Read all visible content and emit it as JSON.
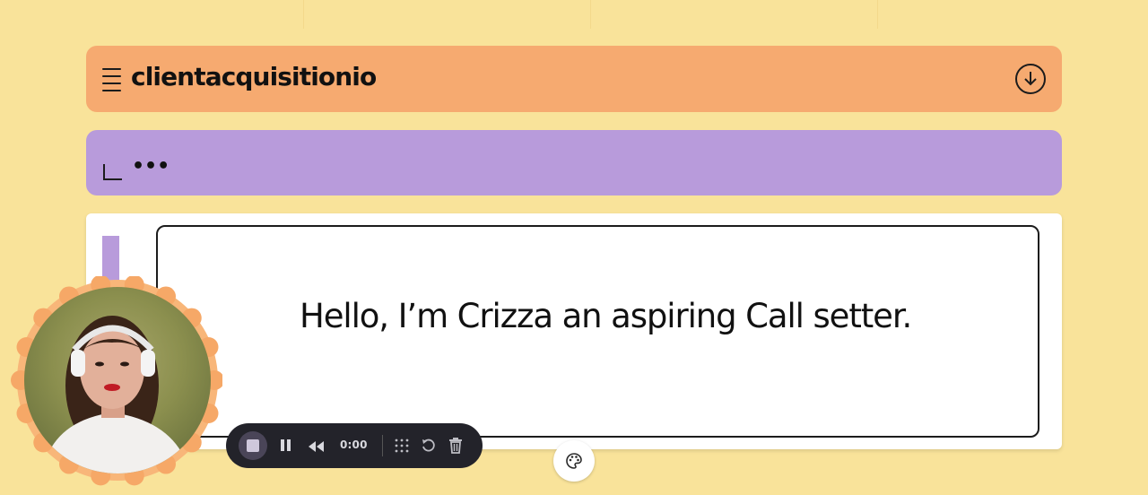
{
  "header": {
    "title": "clientacquisitionio",
    "menu_icon": "hamburger-menu-icon",
    "download_icon": "download-circle-icon",
    "color": "#f6aa70"
  },
  "subbar": {
    "more_label": "•••",
    "corner_icon": "corner-bracket-icon",
    "color": "#b89bdb"
  },
  "slide": {
    "text": "Hello, I’m Crizza an aspiring Call setter."
  },
  "recorder": {
    "time": "0:00",
    "buttons": [
      "stop-icon",
      "pause-icon",
      "rewind-icon",
      "grid-dots-icon",
      "restart-icon",
      "trash-icon"
    ]
  },
  "theme": {
    "page_background": "#f9e39a",
    "recorder_background": "#23232a"
  },
  "palette_icon": "palette-icon"
}
